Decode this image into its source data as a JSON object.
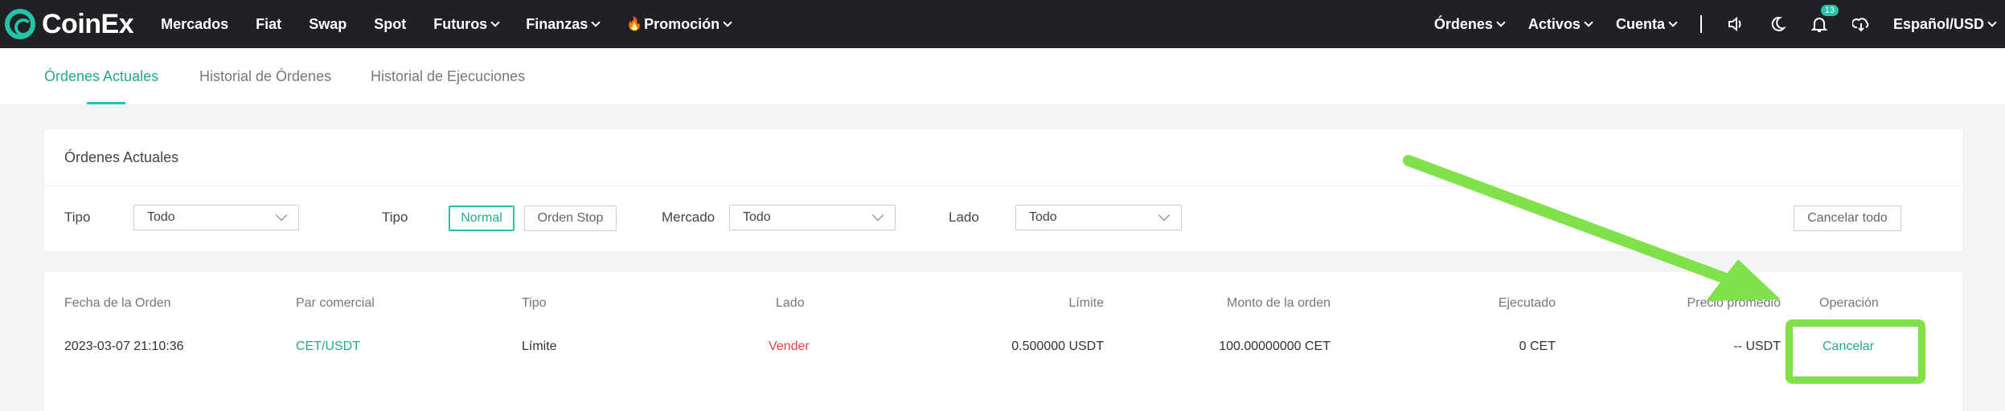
{
  "brand": {
    "name": "CoinEx"
  },
  "nav": {
    "left": [
      "Mercados",
      "Fiat",
      "Swap",
      "Spot"
    ],
    "futuros": "Futuros",
    "finanzas": "Finanzas",
    "promocion": "Promoción",
    "right": {
      "ordenes": "Órdenes",
      "activos": "Activos",
      "cuenta": "Cuenta",
      "lang": "Español/USD"
    },
    "notifications_count": "13"
  },
  "tabs": [
    "Órdenes Actuales",
    "Historial de Órdenes",
    "Historial de Ejecuciones"
  ],
  "filters": {
    "title": "Órdenes Actuales",
    "tipo1_label": "Tipo",
    "tipo1_value": "Todo",
    "tipo2_label": "Tipo",
    "tipo_normal": "Normal",
    "tipo_stop": "Orden Stop",
    "mercado_label": "Mercado",
    "mercado_value": "Todo",
    "lado_label": "Lado",
    "lado_value": "Todo",
    "cancel_all": "Cancelar todo"
  },
  "table": {
    "headers": [
      "Fecha de la Orden",
      "Par comercial",
      "Tipo",
      "Lado",
      "Límite",
      "Monto de la orden",
      "Ejecutado",
      "Precio promedio",
      "Operación"
    ],
    "row": {
      "fecha": "2023-03-07 21:10:36",
      "par": "CET/USDT",
      "tipo": "Límite",
      "lado": "Vender",
      "limite": "0.500000 USDT",
      "monto": "100.00000000 CET",
      "ejecutado": "0 CET",
      "promedio": "-- USDT",
      "operacion": "Cancelar"
    }
  },
  "colors": {
    "accent": "#25c3a7",
    "sell": "#e1453c",
    "annotation": "#7fe24a",
    "nav_bg": "#202124"
  }
}
